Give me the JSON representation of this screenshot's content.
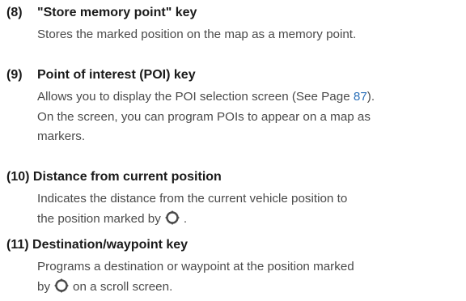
{
  "entries": [
    {
      "number": "(8)",
      "title": "\"Store memory point\" key",
      "text": "Stores the marked position on the map as a memory point."
    },
    {
      "number": "(9)",
      "title": "Point of interest (POI) key",
      "line1_before": "Allows you to display the POI selection screen (See Page ",
      "page_ref": "87",
      "line1_after": ").",
      "line2": "On the screen, you can program POIs to appear on a map as",
      "line3": "markers."
    },
    {
      "heading": "(10) Distance from current position",
      "line1": "Indicates the distance from the current vehicle position to",
      "line2_before": "the position marked by",
      "line2_after": "."
    },
    {
      "heading": "(11) Destination/waypoint key",
      "line1": "Programs a destination or waypoint at the position marked",
      "line2_before": "by",
      "line2_after": "on a scroll screen."
    }
  ],
  "icons": {
    "marker": "position-cursor-icon",
    "page_ref_color": "#2a6fb8"
  }
}
